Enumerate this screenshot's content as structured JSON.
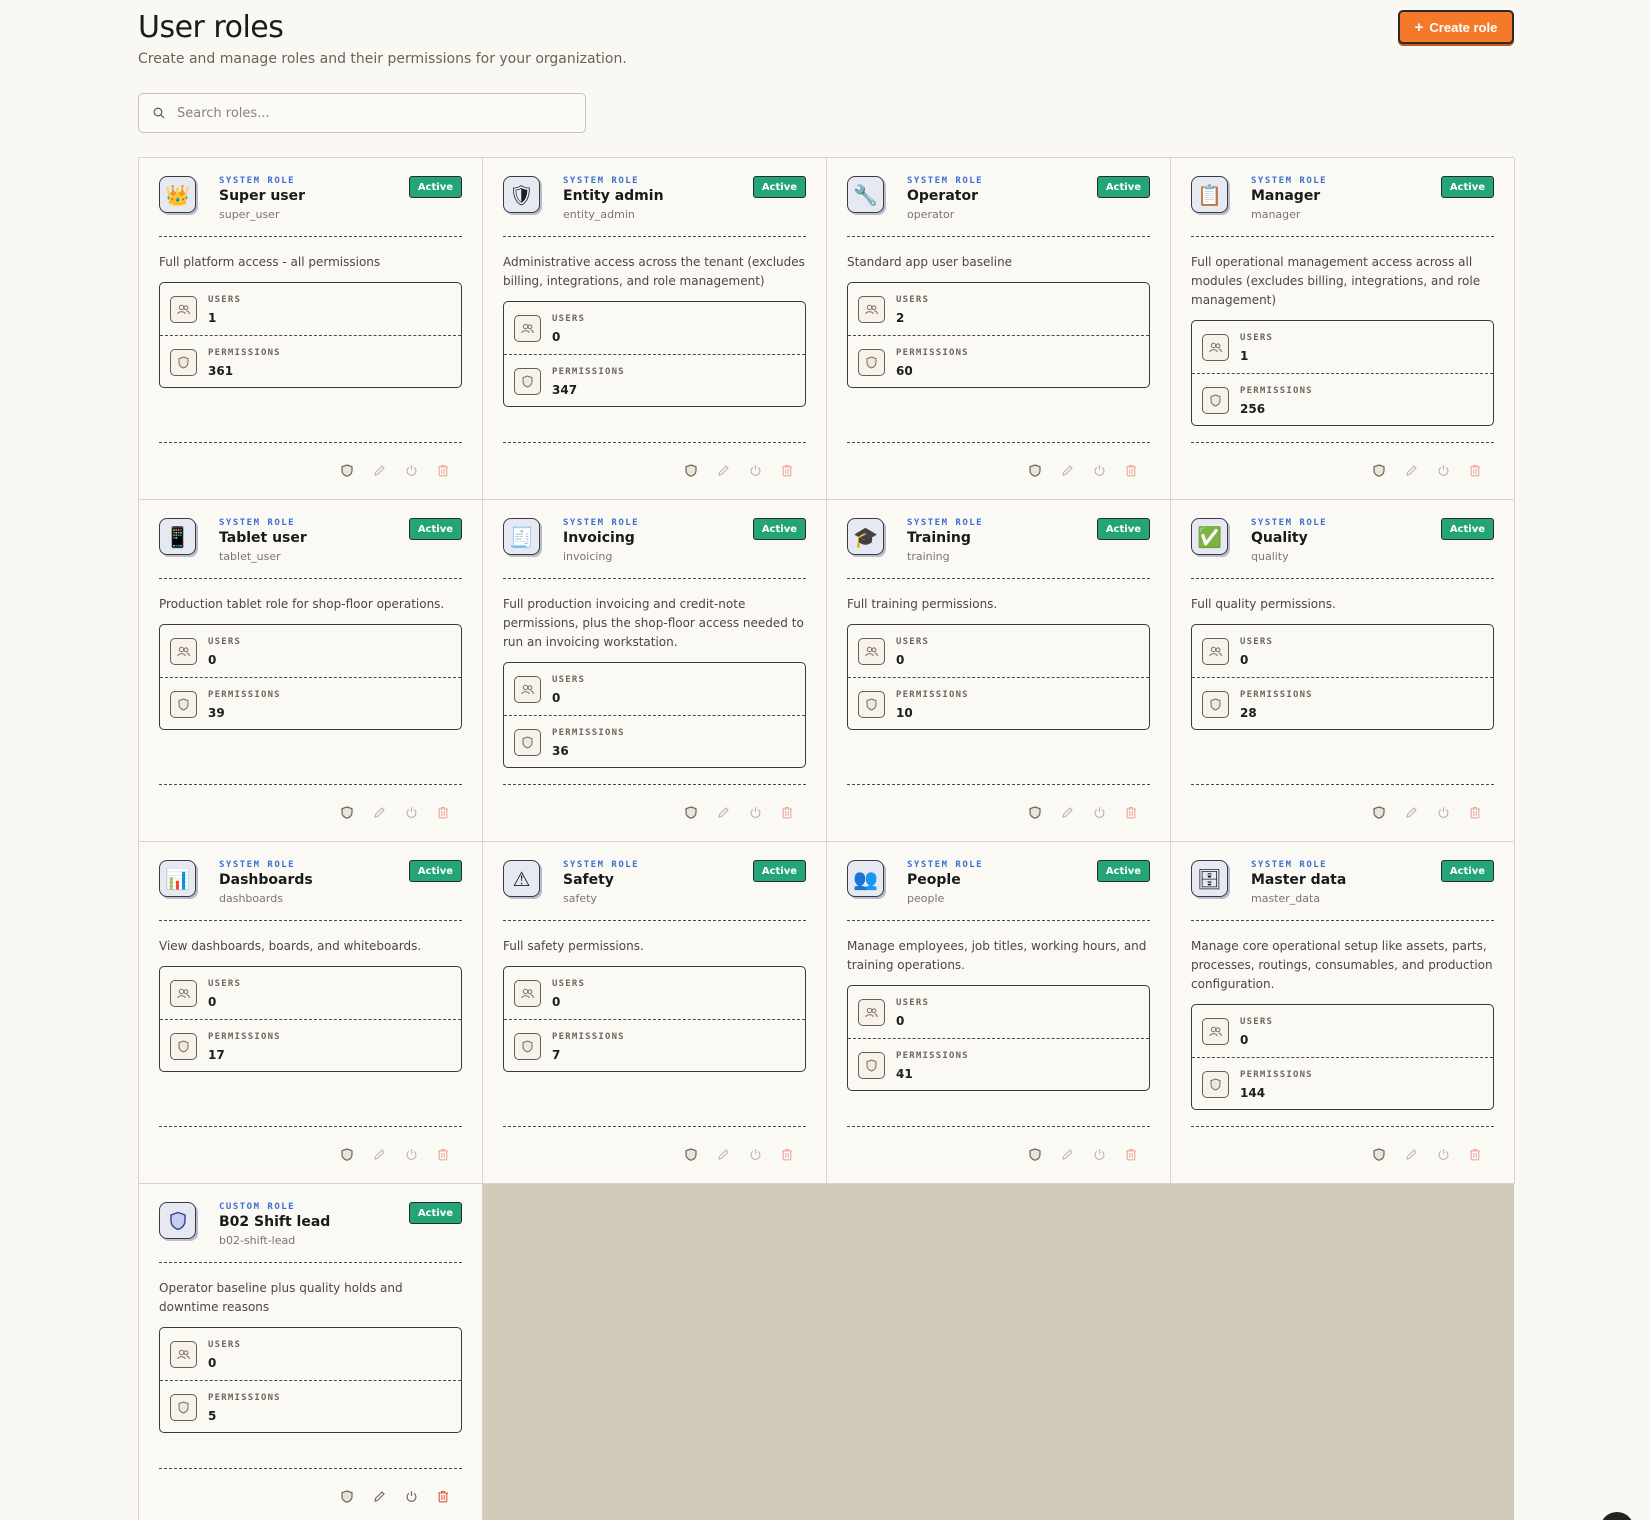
{
  "header": {
    "title": "User roles",
    "subtitle": "Create and manage roles and their permissions for your organization.",
    "create_label": "Create role"
  },
  "search": {
    "placeholder": "Search roles..."
  },
  "stat_labels": {
    "users": "USERS",
    "permissions": "PERMISSIONS"
  },
  "colors": {
    "accent": "#f47a2a",
    "active": "#23a577",
    "role_kind": "#3b6fd1",
    "delete": "#e06b5b"
  },
  "roles": [
    {
      "kind": "SYSTEM ROLE",
      "name": "Super user",
      "key": "super_user",
      "status": "Active",
      "icon": "👑",
      "icon_name": "crown-icon",
      "description": "Full platform access - all permissions",
      "users": "1",
      "permissions": "361"
    },
    {
      "kind": "SYSTEM ROLE",
      "name": "Entity admin",
      "key": "entity_admin",
      "status": "Active",
      "icon": "🛡",
      "icon_name": "shield-icon",
      "description": "Administrative access across the tenant (excludes billing, integrations, and role management)",
      "users": "0",
      "permissions": "347"
    },
    {
      "kind": "SYSTEM ROLE",
      "name": "Operator",
      "key": "operator",
      "status": "Active",
      "icon": "🔧",
      "icon_name": "wrench-icon",
      "description": "Standard app user baseline",
      "users": "2",
      "permissions": "60"
    },
    {
      "kind": "SYSTEM ROLE",
      "name": "Manager",
      "key": "manager",
      "status": "Active",
      "icon": "📋",
      "icon_name": "clipboard-icon",
      "description": "Full operational management access across all modules (excludes billing, integrations, and role management)",
      "users": "1",
      "permissions": "256"
    },
    {
      "kind": "SYSTEM ROLE",
      "name": "Tablet user",
      "key": "tablet_user",
      "status": "Active",
      "icon": "📱",
      "icon_name": "tablet-icon",
      "description": "Production tablet role for shop-floor operations.",
      "users": "0",
      "permissions": "39"
    },
    {
      "kind": "SYSTEM ROLE",
      "name": "Invoicing",
      "key": "invoicing",
      "status": "Active",
      "icon": "🧾",
      "icon_name": "receipt-icon",
      "description": "Full production invoicing and credit-note permissions, plus the shop-floor access needed to run an invoicing workstation.",
      "users": "0",
      "permissions": "36"
    },
    {
      "kind": "SYSTEM ROLE",
      "name": "Training",
      "key": "training",
      "status": "Active",
      "icon": "🎓",
      "icon_name": "graduation-cap-icon",
      "description": "Full training permissions.",
      "users": "0",
      "permissions": "10"
    },
    {
      "kind": "SYSTEM ROLE",
      "name": "Quality",
      "key": "quality",
      "status": "Active",
      "icon": "✅",
      "icon_name": "check-mark-icon",
      "description": "Full quality permissions.",
      "users": "0",
      "permissions": "28"
    },
    {
      "kind": "SYSTEM ROLE",
      "name": "Dashboards",
      "key": "dashboards",
      "status": "Active",
      "icon": "📊",
      "icon_name": "bar-chart-icon",
      "description": "View dashboards, boards, and whiteboards.",
      "users": "0",
      "permissions": "17"
    },
    {
      "kind": "SYSTEM ROLE",
      "name": "Safety",
      "key": "safety",
      "status": "Active",
      "icon": "⚠",
      "icon_name": "warning-icon",
      "description": "Full safety permissions.",
      "users": "0",
      "permissions": "7"
    },
    {
      "kind": "SYSTEM ROLE",
      "name": "People",
      "key": "people",
      "status": "Active",
      "icon": "👥",
      "icon_name": "people-icon",
      "description": "Manage employees, job titles, working hours, and training operations.",
      "users": "0",
      "permissions": "41"
    },
    {
      "kind": "SYSTEM ROLE",
      "name": "Master data",
      "key": "master_data",
      "status": "Active",
      "icon": "🗄",
      "icon_name": "file-cabinet-icon",
      "description": "Manage core operational setup like assets, parts, processes, routings, consumables, and production configuration.",
      "users": "0",
      "permissions": "144"
    },
    {
      "kind": "CUSTOM ROLE",
      "name": "B02 Shift lead",
      "key": "b02-shift-lead",
      "status": "Active",
      "icon": "",
      "icon_name": "shield-outline-icon",
      "description": "Operator baseline plus quality holds and downtime reasons",
      "users": "0",
      "permissions": "5",
      "custom": true
    }
  ]
}
